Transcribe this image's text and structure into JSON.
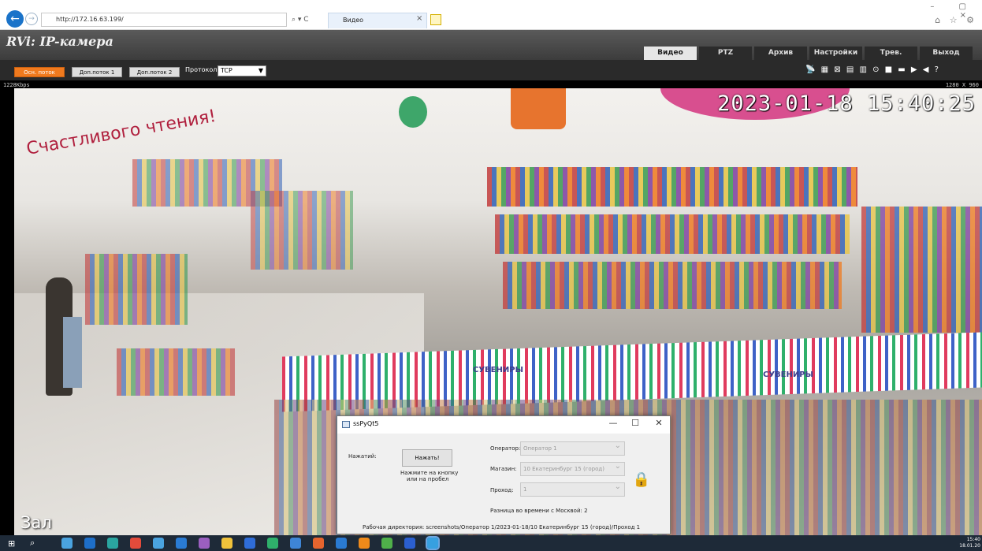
{
  "browser": {
    "url": "http://172.16.63.199/",
    "tab_title": "Видео",
    "tab_close": "×",
    "addr_tools": "⌕ ▾ C",
    "back_icon": "back-arrow-icon",
    "forward_icon": "forward-arrow-icon",
    "window_controls": "– ▢ ×",
    "toolbar_icons": "⌂ ☆ ⚙"
  },
  "app": {
    "logo": "RVi: IP-камера",
    "nav_tabs": [
      "Видео",
      "PTZ",
      "Архив",
      "Настройки",
      "Трев.",
      "Выход"
    ],
    "active_tab": "Видео"
  },
  "stream": {
    "buttons": [
      "Осн. поток",
      "Доп.поток 1",
      "Доп.поток 2"
    ],
    "protocol_label": "Протокол",
    "protocol_value": "TCP",
    "bitrate": "1228Kbps",
    "resolution": "1280 X 960",
    "tool_icons": "📡 ▦ ⊠ ▤ ▥ ⊙ ■ ▬ ▶ ◀ ?"
  },
  "video": {
    "timestamp": "2023-01-18 15:40:25",
    "camera_name": "Зал",
    "sign_text": "Счастливого чтения!",
    "souvenir_label": "СУВЕНИРЫ"
  },
  "dialog": {
    "title": "ssPyQt5",
    "minimize": "—",
    "maximize": "☐",
    "close": "✕",
    "press_label": "Нажатий:",
    "press_button": "Нажать!",
    "press_hint_1": "Нажмите на кнопку",
    "press_hint_2": "или на пробел",
    "operator_label": "Оператор:",
    "operator_value": "Оператор 1",
    "store_label": "Магазин:",
    "store_value": "10 Екатеринбург 15 (город)",
    "pass_label": "Проход:",
    "pass_value": "1",
    "tz_diff": "Разница во времени с Москвой: 2",
    "workdir": "Рабочая директория: screenshots/Оператор 1/2023-01-18/10 Екатеринбург 15 (город)/Проход 1",
    "lock_icon": "🔒"
  },
  "taskbar": {
    "start_icon": "windows-icon",
    "search_icon": "search-icon",
    "time": "15:40",
    "date": "18.01.20",
    "app_colors": [
      "#4aa3df",
      "#1e6fc9",
      "#2aa5a0",
      "#e34b3b",
      "#4aa3df",
      "#2a7bd3",
      "#9b5fc0",
      "#f0c23b",
      "#2f6dd8",
      "#2fb06b",
      "#3e85d6",
      "#e6642e",
      "#2a7bd3",
      "#ef8a1a",
      "#4fb04a",
      "#2b5fd0",
      "#37a0e0"
    ]
  }
}
